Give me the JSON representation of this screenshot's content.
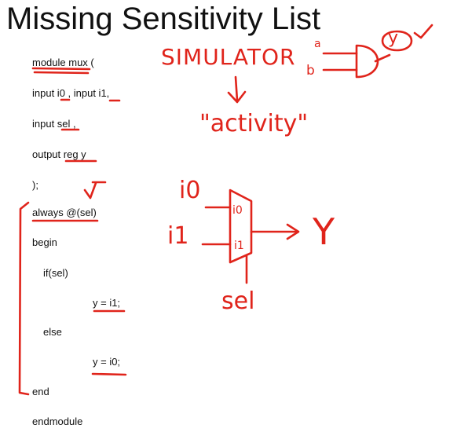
{
  "title": "Missing Sensitivity List",
  "code_lines": [
    "module mux (",
    "input i0 , input i1,",
    "input sel ,",
    "output reg y",
    ");",
    "always @(sel)",
    "begin",
    "if(sel)",
    "y = i1;",
    "else",
    "y = i0;",
    "end",
    "endmodule"
  ],
  "annotations": {
    "simulator": "SIMULATOR",
    "activity": "\"activity\"",
    "gate_input_a": "a",
    "gate_input_b": "b",
    "gate_output": "y",
    "mux_in0": "i0",
    "mux_in1": "i1",
    "mux_port0": "i0",
    "mux_port1": "i1",
    "mux_out": "Y",
    "mux_select": "sel"
  },
  "colors": {
    "ink": "#e0241b",
    "text": "#111111"
  }
}
